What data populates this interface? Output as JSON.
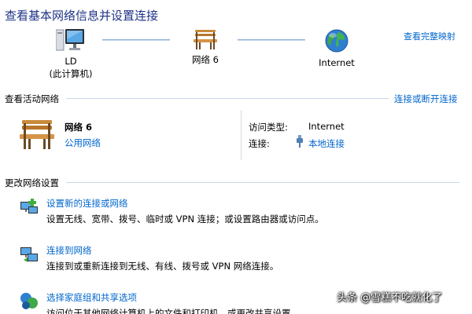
{
  "page_title": "查看基本网络信息并设置连接",
  "map": {
    "see_full_map": "查看完整映射",
    "nodes": [
      {
        "icon": "computer-icon",
        "label_line1": "LD",
        "label_line2": "(此计算机)"
      },
      {
        "icon": "park-bench-icon",
        "label_line1": "网络  6"
      },
      {
        "icon": "globe-icon",
        "label_line1": "Internet"
      }
    ]
  },
  "active_networks": {
    "heading": "查看活动网络",
    "action_link": "连接或断开连接",
    "network_name": "网络  6",
    "network_type": "公用网络",
    "access_type_label": "访问类型:",
    "access_type_value": "Internet",
    "connections_label": "连接:",
    "connections_value": "本地连接"
  },
  "change_settings": {
    "heading": "更改网络设置",
    "tasks": [
      {
        "icon": "new-connection-icon",
        "title": "设置新的连接或网络",
        "description": "设置无线、宽带、拨号、临时或 VPN 连接；或设置路由器或访问点。"
      },
      {
        "icon": "connect-network-icon",
        "title": "连接到网络",
        "description": "连接到或重新连接到无线、有线、拨号或 VPN 网络连接。"
      },
      {
        "icon": "homegroup-icon",
        "title": "选择家庭组和共享选项",
        "description": "访问位于其他网络计算机上的文件和打印机，或更改共享设置。"
      }
    ]
  },
  "watermark": "头条 @雪糕不吃就化了",
  "colors": {
    "title": "#1e3287",
    "link": "#0066cc",
    "rule": "#c9d6e6"
  }
}
